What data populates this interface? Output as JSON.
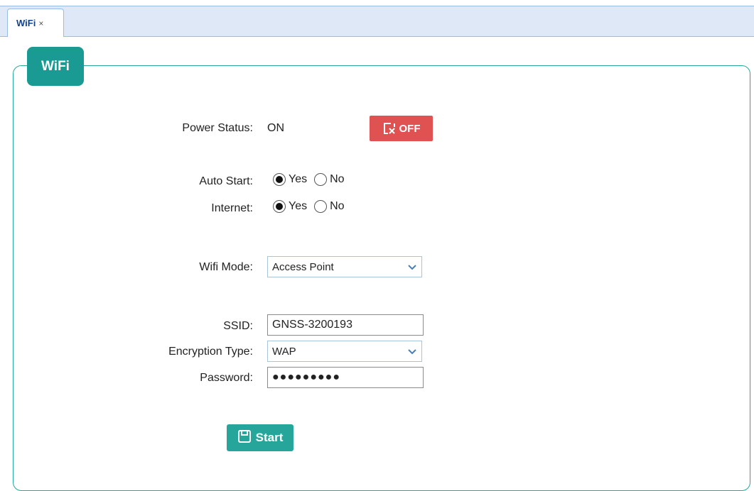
{
  "tabs": [
    {
      "label": "WiFi",
      "close": "×"
    }
  ],
  "panel": {
    "title": "WiFi"
  },
  "power": {
    "label": "Power Status:",
    "value": "ON",
    "button_label": "OFF"
  },
  "auto_start": {
    "label": "Auto Start:",
    "options": [
      "Yes",
      "No"
    ],
    "selected": "Yes"
  },
  "internet": {
    "label": "Internet:",
    "options": [
      "Yes",
      "No"
    ],
    "selected": "Yes"
  },
  "wifi_mode": {
    "label": "Wifi Mode:",
    "value": "Access Point"
  },
  "ssid": {
    "label": "SSID:",
    "value": "GNSS-3200193"
  },
  "encryption": {
    "label": "Encryption Type:",
    "value": "WAP"
  },
  "password": {
    "label": "Password:",
    "value": "●●●●●●●●●"
  },
  "start_button": {
    "label": "Start"
  },
  "colors": {
    "accent": "#199a93",
    "danger": "#e05252",
    "tab_bar": "#dfe8f6"
  },
  "icons": {
    "off_button": "close-box-icon",
    "start_button": "save-icon",
    "select": "chevron-down-icon"
  }
}
